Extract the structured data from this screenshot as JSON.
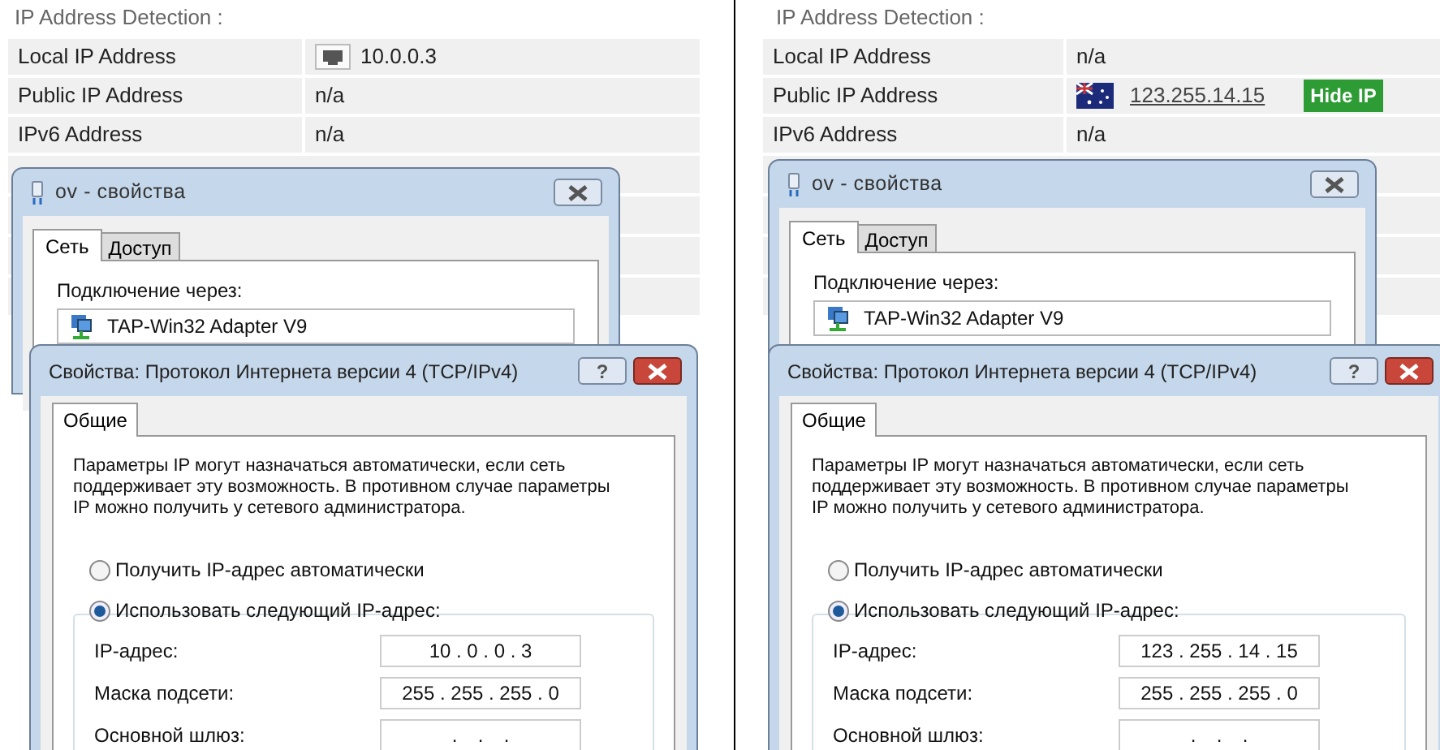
{
  "panels": [
    {
      "heading": "IP Address Detection :",
      "rows": [
        {
          "label": "Local IP Address",
          "kind": "network",
          "value": "10.0.0.3"
        },
        {
          "label": "Public IP Address",
          "kind": "text",
          "value": "n/a"
        },
        {
          "label": "IPv6 Address",
          "kind": "text",
          "value": "n/a"
        }
      ],
      "properties_dialog": {
        "title": "ov - свойства",
        "tabs": [
          {
            "label": "Сеть",
            "selected": true
          },
          {
            "label": "Доступ",
            "selected": false
          }
        ],
        "connect_label": "Подключение через:",
        "adapter": "TAP-Win32 Adapter V9"
      },
      "ipv4_dialog": {
        "title": "Свойства: Протокол Интернета версии 4 (TCP/IPv4)",
        "help": "?",
        "tabs": [
          {
            "label": "Общие",
            "selected": true
          }
        ],
        "description": "Параметры IP могут назначаться автоматически, если сеть поддерживает эту возможность. В противном случае параметры IP можно получить у сетевого администратора.",
        "options": [
          {
            "label": "Получить IP-адрес автоматически",
            "selected": false
          },
          {
            "label": "Использовать следующий IP-адрес:",
            "selected": true
          }
        ],
        "octet_separator": ".",
        "fields": [
          {
            "label": "IP-адрес:",
            "octets": [
              "10",
              "0",
              "0",
              "3"
            ]
          },
          {
            "label": "Маска подсети:",
            "octets": [
              "255",
              "255",
              "255",
              "0"
            ]
          },
          {
            "label": "Основной шлюз:"
          }
        ]
      }
    },
    {
      "heading": "IP Address Detection :",
      "rows": [
        {
          "label": "Local IP Address",
          "kind": "text",
          "value": "n/a"
        },
        {
          "label": "Public IP Address",
          "kind": "flag_link",
          "value": "123.255.14.15",
          "action": "Hide IP"
        },
        {
          "label": "IPv6 Address",
          "kind": "text",
          "value": "n/a"
        }
      ],
      "properties_dialog": {
        "title": "ov - свойства",
        "tabs": [
          {
            "label": "Сеть",
            "selected": true
          },
          {
            "label": "Доступ",
            "selected": false
          }
        ],
        "connect_label": "Подключение через:",
        "adapter": "TAP-Win32 Adapter V9"
      },
      "ipv4_dialog": {
        "title": "Свойства: Протокол Интернета версии 4 (TCP/IPv4)",
        "help": "?",
        "tabs": [
          {
            "label": "Общие",
            "selected": true
          }
        ],
        "description": "Параметры IP могут назначаться автоматически, если сеть поддерживает эту возможность. В противном случае параметры IP можно получить у сетевого администратора.",
        "options": [
          {
            "label": "Получить IP-адрес автоматически",
            "selected": false
          },
          {
            "label": "Использовать следующий IP-адрес:",
            "selected": true
          }
        ],
        "octet_separator": ".",
        "fields": [
          {
            "label": "IP-адрес:",
            "octets": [
              "123",
              "255",
              "14",
              "15"
            ]
          },
          {
            "label": "Маска подсети:",
            "octets": [
              "255",
              "255",
              "255",
              "0"
            ]
          },
          {
            "label": "Основной шлюз:"
          }
        ]
      }
    }
  ]
}
